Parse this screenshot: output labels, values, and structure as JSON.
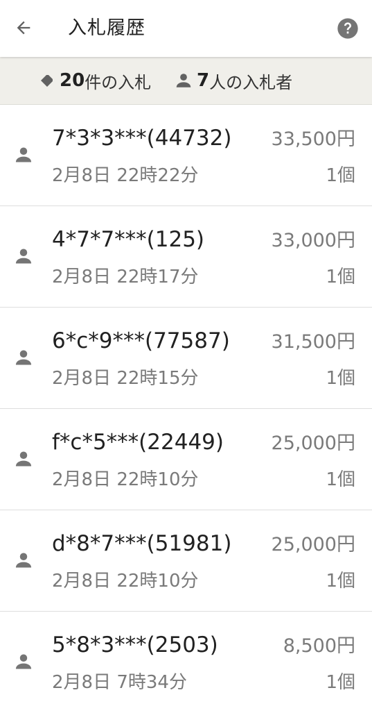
{
  "header": {
    "title": "入札履歴",
    "back_icon": "arrow-left-icon",
    "help_icon": "help-circle-icon"
  },
  "summary": {
    "bid_count": "20",
    "bid_count_suffix": "件の入札",
    "bidder_count": "7",
    "bidder_count_suffix": "人の入札者"
  },
  "bids": [
    {
      "bidder": "7*3*3***(44732)",
      "price": "33,500円",
      "time": "2月8日 22時22分",
      "quantity": "1個"
    },
    {
      "bidder": "4*7*7***(125)",
      "price": "33,000円",
      "time": "2月8日 22時17分",
      "quantity": "1個"
    },
    {
      "bidder": "6*c*9***(77587)",
      "price": "31,500円",
      "time": "2月8日 22時15分",
      "quantity": "1個"
    },
    {
      "bidder": "f*c*5***(22449)",
      "price": "25,000円",
      "time": "2月8日 22時10分",
      "quantity": "1個"
    },
    {
      "bidder": "d*8*7***(51981)",
      "price": "25,000円",
      "time": "2月8日 22時10分",
      "quantity": "1個"
    },
    {
      "bidder": "5*8*3***(2503)",
      "price": "8,500円",
      "time": "2月8日 7時34分",
      "quantity": "1個"
    }
  ],
  "colors": {
    "summary_bg": "#f0efea",
    "icon_gray": "#757575",
    "secondary_text": "#7a7a7a"
  }
}
